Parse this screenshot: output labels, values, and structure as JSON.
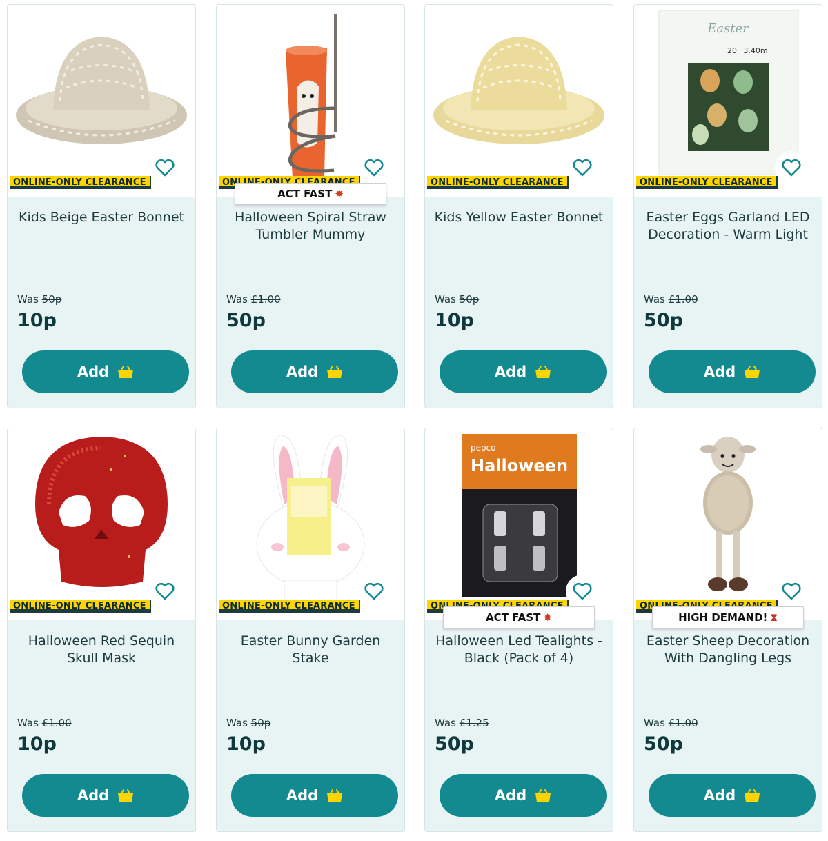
{
  "colors": {
    "accent": "#128a8f",
    "badge": "#ffd400",
    "card_bg": "#e8f3f4",
    "text": "#1d3b3f"
  },
  "labels": {
    "clearance_badge": "ONLINE-ONLY CLEARANCE",
    "was_prefix": "Was",
    "add_button": "Add"
  },
  "products": [
    {
      "title": "Kids Beige Easter Bonnet",
      "was": "50p",
      "price": "10p",
      "tag": "",
      "image": "beige-bonnet"
    },
    {
      "title": "Halloween Spiral Straw Tumbler Mummy",
      "was": "£1.00",
      "price": "50p",
      "tag": "ACT FAST",
      "image": "mummy-tumbler"
    },
    {
      "title": "Kids Yellow Easter Bonnet",
      "was": "50p",
      "price": "10p",
      "tag": "",
      "image": "yellow-bonnet"
    },
    {
      "title": "Easter Eggs Garland LED Decoration - Warm Light",
      "was": "£1.00",
      "price": "50p",
      "tag": "",
      "image": "egg-garland"
    },
    {
      "title": "Halloween Red Sequin Skull Mask",
      "was": "£1.00",
      "price": "10p",
      "tag": "",
      "image": "skull-mask"
    },
    {
      "title": "Easter Bunny Garden Stake",
      "was": "50p",
      "price": "10p",
      "tag": "",
      "image": "bunny-stake"
    },
    {
      "title": "Halloween Led Tealights - Black (Pack of 4)",
      "was": "£1.25",
      "price": "50p",
      "tag": "ACT FAST",
      "image": "tealights"
    },
    {
      "title": "Easter Sheep Decoration With Dangling Legs",
      "was": "£1.00",
      "price": "50p",
      "tag": "HIGH DEMAND!",
      "image": "sheep"
    }
  ],
  "package_text": {
    "garland_brand": "Easter",
    "garland_count": "20",
    "garland_length": "3.40m",
    "tealight_brand": "pepco",
    "tealight_title": "Halloween"
  }
}
